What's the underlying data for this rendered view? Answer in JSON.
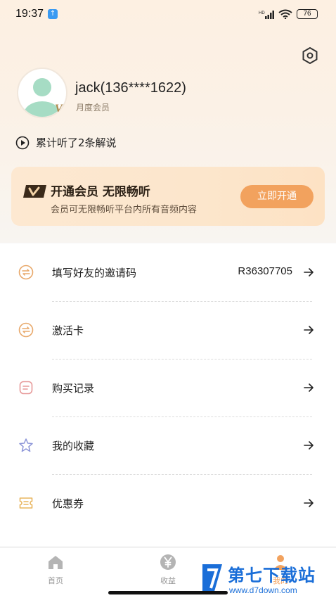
{
  "status_bar": {
    "time": "19:37",
    "battery": "76"
  },
  "profile": {
    "username": "jack(136****1622)",
    "member_level": "月度会员",
    "listen_summary": "累计听了2条解说"
  },
  "vip_banner": {
    "title": "开通会员  无限畅听",
    "subtitle": "会员可无限畅听平台内所有音频内容",
    "button_label": "立即开通"
  },
  "menu": [
    {
      "label": "填写好友的邀请码",
      "value": "R36307705",
      "icon": "invite-icon"
    },
    {
      "label": "激活卡",
      "value": "",
      "icon": "activation-card-icon"
    },
    {
      "label": "购买记录",
      "value": "",
      "icon": "purchase-record-icon"
    },
    {
      "label": "我的收藏",
      "value": "",
      "icon": "star-icon"
    },
    {
      "label": "优惠券",
      "value": "",
      "icon": "coupon-icon"
    }
  ],
  "tabs": [
    {
      "label": "首页",
      "icon": "home-icon"
    },
    {
      "label": "收益",
      "icon": "yen-icon"
    },
    {
      "label": "我的",
      "icon": "profile-icon"
    }
  ],
  "watermark": {
    "title": "第七下载站",
    "url": "www.d7down.com"
  },
  "colors": {
    "accent": "#f2a25e",
    "icon_orange": "#e8a86a",
    "icon_pink": "#e79a9a",
    "icon_blue": "#8d96d8"
  }
}
